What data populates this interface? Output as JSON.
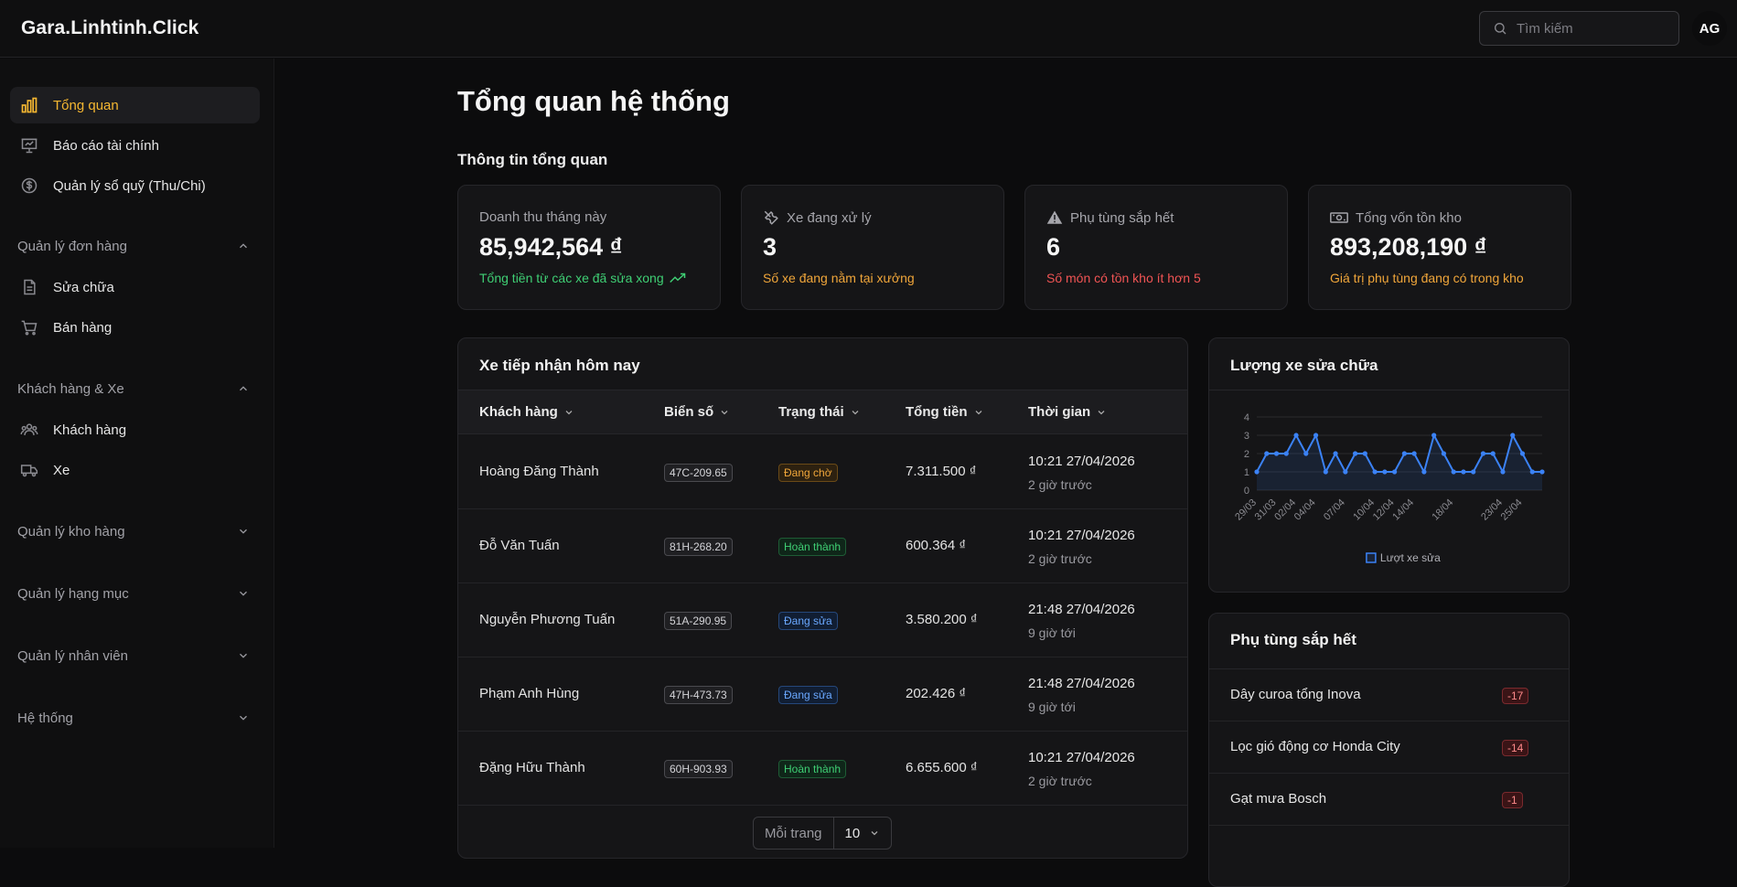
{
  "header": {
    "brand": "Gara.Linhtinh.Click",
    "search_placeholder": "Tìm kiếm",
    "avatar_initials": "AG"
  },
  "sidebar": {
    "items": [
      {
        "label": "Tổng quan",
        "icon": "bar-chart-icon",
        "active": true
      },
      {
        "label": "Báo cáo tài chính",
        "icon": "presentation-icon"
      },
      {
        "label": "Quản lý sổ quỹ (Thu/Chi)",
        "icon": "dollar-circle-icon"
      }
    ],
    "groups": [
      {
        "label": "Quản lý đơn hàng",
        "expanded": true,
        "items": [
          {
            "label": "Sửa chữa",
            "icon": "document-icon"
          },
          {
            "label": "Bán hàng",
            "icon": "cart-icon"
          }
        ]
      },
      {
        "label": "Khách hàng & Xe",
        "expanded": true,
        "items": [
          {
            "label": "Khách hàng",
            "icon": "users-icon"
          },
          {
            "label": "Xe",
            "icon": "truck-icon"
          }
        ]
      },
      {
        "label": "Quản lý kho hàng",
        "expanded": false
      },
      {
        "label": "Quản lý hạng mục",
        "expanded": false
      },
      {
        "label": "Quản lý nhân viên",
        "expanded": false
      },
      {
        "label": "Hệ thống",
        "expanded": false
      }
    ]
  },
  "main": {
    "title": "Tổng quan hệ thống",
    "overview_title": "Thông tin tổng quan",
    "cards": [
      {
        "label": "Doanh thu tháng này",
        "value": "85,942,564 ₫",
        "sub": "Tổng tiền từ các xe đã sửa xong",
        "sub_color": "#3fcf74",
        "icon": "trending-up-icon"
      },
      {
        "label": "Xe đang xử lý",
        "value": "3",
        "sub": "Số xe đang nằm tại xưởng",
        "sub_color": "#f0a63a",
        "icon": "tools-icon"
      },
      {
        "label": "Phụ tùng sắp hết",
        "value": "6",
        "sub": "Số món có tồn kho ít hơn 5",
        "sub_color": "#f05454",
        "icon": "warning-icon"
      },
      {
        "label": "Tổng vốn tồn kho",
        "value": "893,208,190 ₫",
        "sub": "Giá trị phụ tùng đang có trong kho",
        "sub_color": "#f0a63a",
        "icon": "cash-icon"
      }
    ],
    "reception": {
      "title": "Xe tiếp nhận hôm nay",
      "columns": [
        "Khách hàng",
        "Biển số",
        "Trạng thái",
        "Tổng tiền",
        "Thời gian"
      ],
      "rows": [
        {
          "customer": "Hoàng Đăng Thành",
          "plate": "47C-209.65",
          "status": "Đang chờ",
          "status_type": "wait",
          "total": "7.311.500 ₫",
          "time": "10:21 27/04/2026",
          "relative": "2 giờ trước"
        },
        {
          "customer": "Đỗ Văn Tuấn",
          "plate": "81H-268.20",
          "status": "Hoàn thành",
          "status_type": "done",
          "total": "600.364 ₫",
          "time": "10:21 27/04/2026",
          "relative": "2 giờ trước"
        },
        {
          "customer": "Nguyễn Phương Tuấn",
          "plate": "51A-290.95",
          "status": "Đang sửa",
          "status_type": "fix",
          "total": "3.580.200 ₫",
          "time": "21:48 27/04/2026",
          "relative": "9 giờ tới"
        },
        {
          "customer": "Phạm Anh Hùng",
          "plate": "47H-473.73",
          "status": "Đang sửa",
          "status_type": "fix",
          "total": "202.426 ₫",
          "time": "21:48 27/04/2026",
          "relative": "9 giờ tới"
        },
        {
          "customer": "Đặng Hữu Thành",
          "plate": "60H-903.93",
          "status": "Hoàn thành",
          "status_type": "done",
          "total": "6.655.600 ₫",
          "time": "10:21 27/04/2026",
          "relative": "2 giờ trước"
        }
      ],
      "pager_label": "Mỗi trang",
      "pager_value": "10"
    },
    "repair_chart_title": "Lượng xe sửa chữa",
    "parts": {
      "title": "Phụ tùng sắp hết",
      "items": [
        {
          "name": "Dây curoa tổng Inova",
          "qty": "-17"
        },
        {
          "name": "Lọc gió động cơ Honda City",
          "qty": "-14"
        },
        {
          "name": "Gạt mưa Bosch",
          "qty": "-1"
        }
      ]
    }
  },
  "colors": {
    "accent": "#f5b731",
    "success": "#3fcf74",
    "warning": "#f0a63a",
    "danger": "#f05454",
    "chart_line": "#3b82f6"
  },
  "chart_data": {
    "type": "line",
    "title": "",
    "legend": "Lượt xe sửa",
    "legend_position": "bottom",
    "x": [
      "29/03",
      "30/03",
      "31/03",
      "01/04",
      "02/04",
      "03/04",
      "04/04",
      "05/04",
      "06/04",
      "07/04",
      "08/04",
      "09/04",
      "10/04",
      "11/04",
      "12/04",
      "13/04",
      "14/04",
      "15/04",
      "16/04",
      "17/04",
      "18/04",
      "19/04",
      "20/04",
      "21/04",
      "22/04",
      "23/04",
      "24/04",
      "25/04",
      "26/04",
      "27/04"
    ],
    "x_tick_labels": [
      "29/03",
      "31/03",
      "02/04",
      "04/04",
      "07/04",
      "10/04",
      "12/04",
      "14/04",
      "18/04",
      "23/04",
      "25/04"
    ],
    "series": [
      {
        "name": "Lượt xe sửa",
        "values": [
          1,
          2,
          2,
          2,
          3,
          2,
          3,
          1,
          2,
          1,
          2,
          2,
          1,
          1,
          1,
          2,
          2,
          1,
          3,
          2,
          1,
          1,
          1,
          2,
          2,
          1,
          3,
          2,
          1,
          1
        ]
      }
    ],
    "ylim": [
      0,
      4
    ],
    "y_ticks": [
      0,
      1,
      2,
      3,
      4
    ],
    "grid": true
  }
}
